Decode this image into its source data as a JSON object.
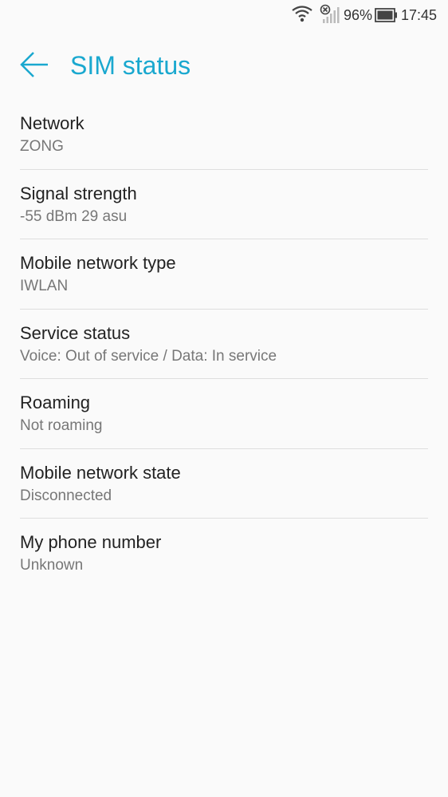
{
  "status_bar": {
    "battery_percent": "96%",
    "time": "17:45",
    "icons": [
      "wifi-icon",
      "signal-no-sim-icon",
      "battery-icon"
    ]
  },
  "header": {
    "title": "SIM status",
    "back_icon": "back-arrow-icon",
    "accent_color": "#1aa8cf"
  },
  "items": [
    {
      "title": "Network",
      "value": "ZONG"
    },
    {
      "title": "Signal strength",
      "value": "-55 dBm 29 asu"
    },
    {
      "title": "Mobile network type",
      "value": "IWLAN"
    },
    {
      "title": "Service status",
      "value": "Voice: Out of service / Data: In service"
    },
    {
      "title": "Roaming",
      "value": "Not roaming"
    },
    {
      "title": "Mobile network state",
      "value": "Disconnected"
    },
    {
      "title": "My phone number",
      "value": "Unknown"
    }
  ]
}
